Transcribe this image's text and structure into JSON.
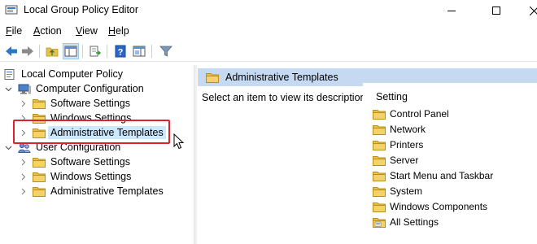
{
  "window": {
    "title": "Local Group Policy Editor",
    "controls": [
      "minimize-icon",
      "maximize-icon",
      "close-icon"
    ]
  },
  "menu": [
    {
      "label": "File",
      "accel": "F",
      "rest": "ile"
    },
    {
      "label": "Action",
      "accel": "A",
      "rest": "ction"
    },
    {
      "label": "View",
      "accel": "V",
      "rest": "iew"
    },
    {
      "label": "Help",
      "accel": "H",
      "rest": "elp"
    }
  ],
  "toolbar": {
    "buttons": [
      "back-arrow-icon",
      "forward-arrow-icon",
      "up-folder-icon",
      "show-hide-tree-icon",
      "export-list-icon",
      "help-icon",
      "properties-pane-icon",
      "filter-icon"
    ],
    "pressed": "show-hide-tree-icon"
  },
  "tree": {
    "root": "Local Computer Policy",
    "computer_configuration": {
      "label": "Computer Configuration",
      "children": [
        "Software Settings",
        "Windows Settings",
        "Administrative Templates"
      ]
    },
    "user_configuration": {
      "label": "User Configuration",
      "children": [
        "Software Settings",
        "Windows Settings",
        "Administrative Templates"
      ]
    },
    "selected": "Administrative Templates"
  },
  "details": {
    "header_title": "Administrative Templates",
    "description_hint": "Select an item to view its description.",
    "column_header": "Setting",
    "items": [
      "Control Panel",
      "Network",
      "Printers",
      "Server",
      "Start Menu and Taskbar",
      "System",
      "Windows Components",
      "All Settings"
    ]
  },
  "colors": {
    "folder_yellow": "#e8c04a",
    "header_blue": "#c5d9f1",
    "selection_blue": "#cce8ff",
    "highlight_red": "#d9232e"
  }
}
